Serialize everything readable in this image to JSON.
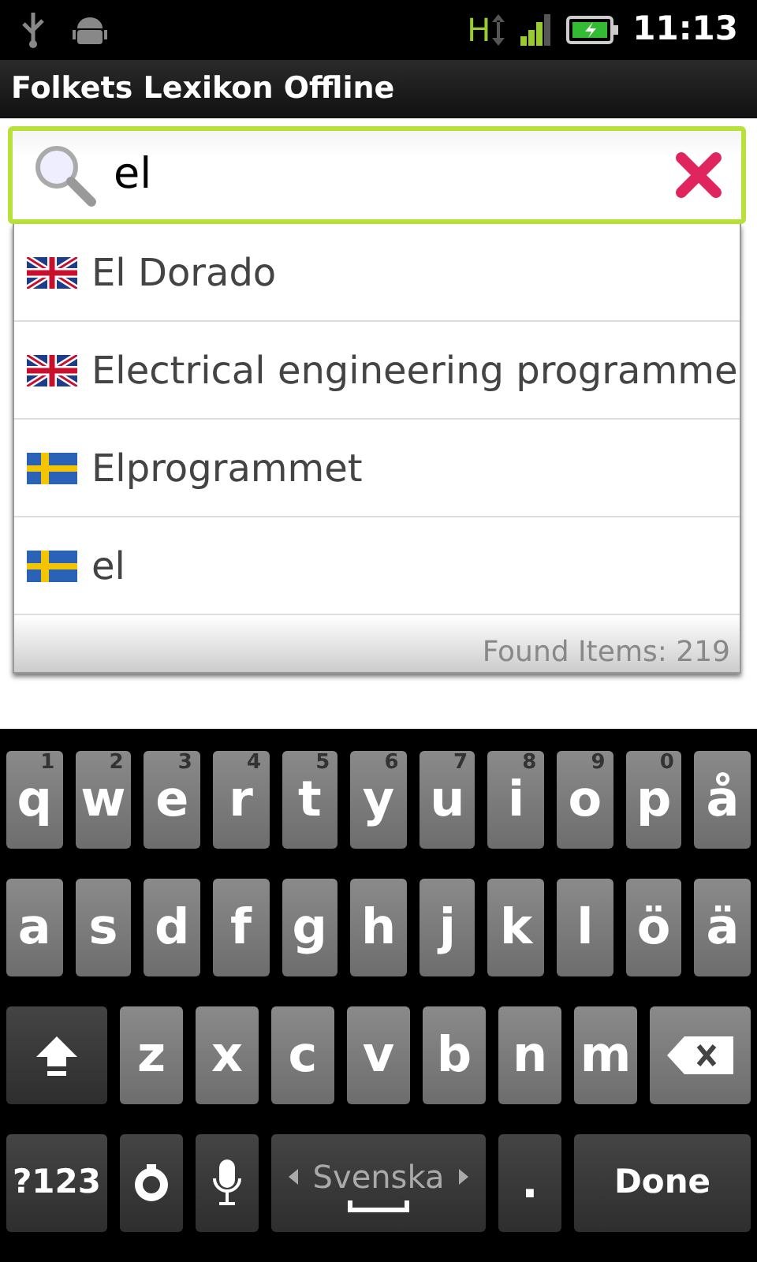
{
  "status_bar": {
    "network": "H",
    "time": "11:13"
  },
  "app_title": "Folkets Lexikon Offline",
  "search": {
    "value": "el"
  },
  "suggestions": [
    {
      "text": "El Dorado",
      "kind": "english"
    },
    {
      "text": "Electrical engineering programme",
      "kind": "english"
    },
    {
      "text": "Elprogrammet",
      "kind": "swedish"
    },
    {
      "text": "el",
      "kind": "swedish"
    }
  ],
  "found_items": "Found Items: 219",
  "keyboard": {
    "rows": [
      {
        "keys": [
          {
            "kind": "letter",
            "label": "q",
            "hint": "1"
          },
          {
            "kind": "letter",
            "label": "w",
            "hint": "2"
          },
          {
            "kind": "letter",
            "label": "e",
            "hint": "3"
          },
          {
            "kind": "letter",
            "label": "r",
            "hint": "4"
          },
          {
            "kind": "letter",
            "label": "t",
            "hint": "5"
          },
          {
            "kind": "letter",
            "label": "y",
            "hint": "6"
          },
          {
            "kind": "letter",
            "label": "u",
            "hint": "7"
          },
          {
            "kind": "letter",
            "label": "i",
            "hint": "8"
          },
          {
            "kind": "letter",
            "label": "o",
            "hint": "9"
          },
          {
            "kind": "letter",
            "label": "p",
            "hint": "0"
          },
          {
            "kind": "letter",
            "label": "å"
          }
        ]
      },
      {
        "keys": [
          {
            "kind": "letter",
            "label": "a"
          },
          {
            "kind": "letter",
            "label": "s"
          },
          {
            "kind": "letter",
            "label": "d"
          },
          {
            "kind": "letter",
            "label": "f"
          },
          {
            "kind": "letter",
            "label": "g"
          },
          {
            "kind": "letter",
            "label": "h"
          },
          {
            "kind": "letter",
            "label": "j"
          },
          {
            "kind": "letter",
            "label": "k"
          },
          {
            "kind": "letter",
            "label": "l"
          },
          {
            "kind": "letter",
            "label": "ö"
          },
          {
            "kind": "letter",
            "label": "ä"
          }
        ]
      },
      {
        "keys": [
          {
            "kind": "shift"
          },
          {
            "kind": "letter",
            "label": "z"
          },
          {
            "kind": "letter",
            "label": "x"
          },
          {
            "kind": "letter",
            "label": "c"
          },
          {
            "kind": "letter",
            "label": "v"
          },
          {
            "kind": "letter",
            "label": "b"
          },
          {
            "kind": "letter",
            "label": "n"
          },
          {
            "kind": "letter",
            "label": "m"
          },
          {
            "kind": "backspace"
          }
        ]
      },
      {
        "keys": [
          {
            "kind": "symbols",
            "label": "?123"
          },
          {
            "kind": "settings"
          },
          {
            "kind": "mic"
          },
          {
            "kind": "space",
            "label": "Svenska"
          },
          {
            "kind": "period",
            "label": "."
          },
          {
            "kind": "done",
            "label": "Done"
          }
        ]
      }
    ]
  }
}
